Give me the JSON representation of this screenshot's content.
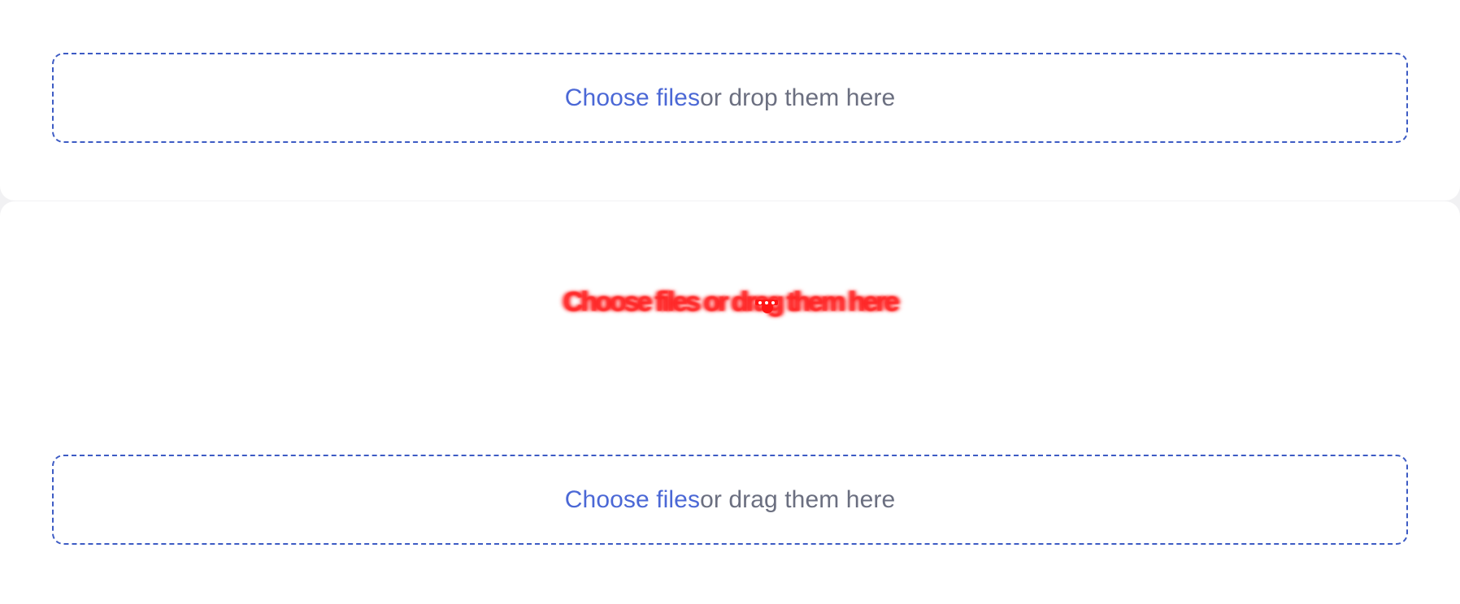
{
  "top_dropzone": {
    "link_label": "Choose files",
    "helper_text": " or drop them here"
  },
  "drag_preview": {
    "text": "Choose files or drag them here"
  },
  "bottom_dropzone": {
    "link_label": "Choose files",
    "helper_text": " or drag them here"
  },
  "colors": {
    "accent": "#4b68d6",
    "border": "#3d5bc4",
    "muted_text": "#6b6f80",
    "drag_ghost": "#ff1e1e",
    "background": "#f1f1f3",
    "card": "#ffffff"
  },
  "icons": {
    "drag_cursor": "drag-cursor-icon"
  }
}
